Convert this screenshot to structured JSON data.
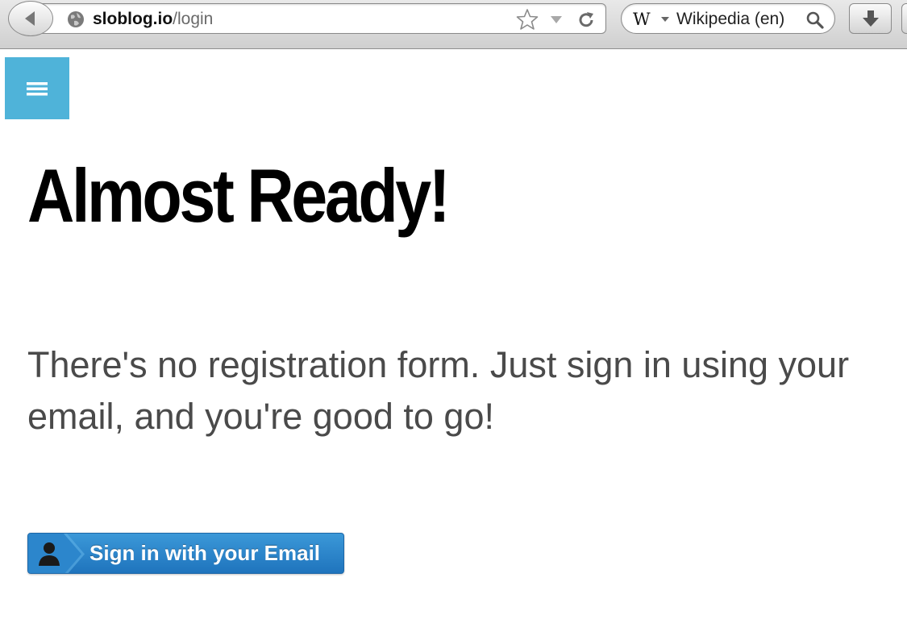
{
  "browser": {
    "url_domain": "sloblog.io",
    "url_path": "/login",
    "search_engine_letter": "W",
    "search_engine": "Wikipedia (en)"
  },
  "page": {
    "heading": "Almost Ready!",
    "intro": "There's no registration form. Just sign in using your email, and you're good to go!",
    "signin_button_label": "Sign in with your Email"
  },
  "colors": {
    "menu_button": "#4fb3d9",
    "signin_button": "#2a85cb",
    "heading_text": "#000000",
    "intro_text": "#4a4a4a"
  },
  "icons": {
    "back": "back-arrow-icon",
    "site": "globe-icon",
    "bookmark": "star-icon",
    "reload": "reload-icon",
    "search": "magnifier-icon",
    "downloads": "download-arrow-icon",
    "menu": "hamburger-icon",
    "user": "user-silhouette-icon"
  }
}
